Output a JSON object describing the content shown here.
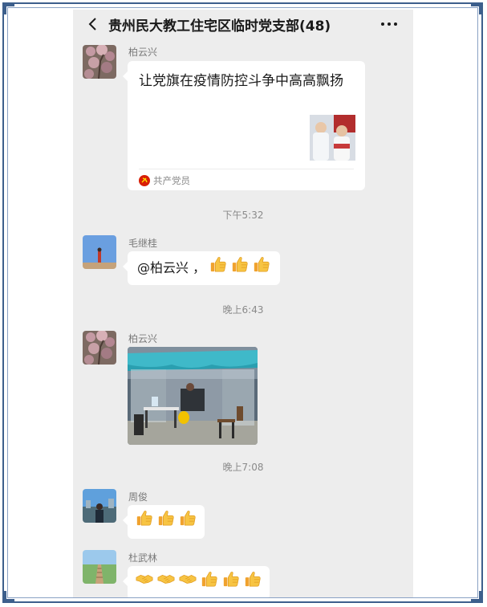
{
  "header": {
    "title": "贵州民大教工住宅区临时党支部(48)",
    "more_label": "···"
  },
  "messages": [
    {
      "sender": "柏云兴",
      "type": "link-card",
      "card_title": "让党旗在疫情防控斗争中高高飘扬",
      "card_source": "共产党员"
    },
    {
      "time": "下午5:32",
      "sender": "毛继桂",
      "type": "text",
      "text": "@柏云兴 ，",
      "emoji": [
        "thumbs-up",
        "thumbs-up",
        "thumbs-up"
      ]
    },
    {
      "time": "晚上6:43",
      "sender": "柏云兴",
      "type": "image"
    },
    {
      "time": "晚上7:08",
      "sender": "周俊",
      "type": "emoji",
      "emoji": [
        "thumbs-up",
        "thumbs-up",
        "thumbs-up"
      ]
    },
    {
      "sender": "杜武林",
      "type": "emoji",
      "emoji": [
        "handshake",
        "handshake",
        "handshake",
        "thumbs-up",
        "thumbs-up",
        "thumbs-up"
      ]
    }
  ],
  "colors": {
    "chat_background": "#ededed",
    "bubble": "#ffffff",
    "frame": "#3d5f8c"
  }
}
